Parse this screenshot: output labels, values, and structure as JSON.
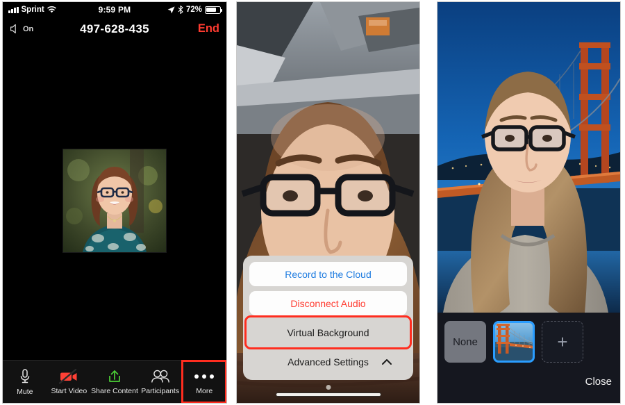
{
  "panel1": {
    "name": "zoom-meeting-in-call",
    "status_bar": {
      "signal_icon": "signal-bars-icon",
      "carrier": "Sprint",
      "wifi_icon": "wifi-icon",
      "time": "9:59 PM",
      "location_icon": "location-arrow-icon",
      "bluetooth_icon": "bluetooth-icon",
      "battery_percent": "72%",
      "battery_icon": "battery-icon"
    },
    "call_bar": {
      "speaker_icon": "speaker-icon",
      "speaker_state": "On",
      "meeting_id": "497-628-435",
      "end_label": "End"
    },
    "video_thumbnail": {
      "name": "participant-video-thumbnail",
      "alt": "participant headshot"
    },
    "toolbar": [
      {
        "icon": "microphone-icon",
        "label": "Mute",
        "highlighted": false
      },
      {
        "icon": "video-off-icon",
        "label": "Start Video",
        "highlighted": false
      },
      {
        "icon": "share-content-icon",
        "label": "Share Content",
        "highlighted": false
      },
      {
        "icon": "participants-icon",
        "label": "Participants",
        "highlighted": false
      },
      {
        "icon": "more-dots-icon",
        "label": "More",
        "highlighted": true
      }
    ]
  },
  "panel2": {
    "name": "more-action-sheet",
    "sheet_items": [
      {
        "label": "Record to the Cloud",
        "style": "blue",
        "highlighted": false
      },
      {
        "label": "Disconnect Audio",
        "style": "red",
        "highlighted": false
      },
      {
        "label": "Virtual Background",
        "style": "plain",
        "highlighted": true
      },
      {
        "label": "Advanced Settings",
        "style": "plain",
        "highlighted": false,
        "accessory_icon": "chevron-up-icon"
      }
    ],
    "home_indicator": "home-indicator"
  },
  "panel3": {
    "name": "virtual-background-picker",
    "backgrounds": [
      {
        "label": "None",
        "type": "none",
        "selected": false
      },
      {
        "label": "",
        "type": "image",
        "image_name": "golden-gate-bridge-background",
        "selected": true
      },
      {
        "label": "+",
        "type": "add",
        "selected": false
      }
    ],
    "close_label": "Close"
  },
  "colors": {
    "highlight_red": "#ff2d1f",
    "end_red": "#ff3b30",
    "accent_blue": "#1f7ce0",
    "selected_blue": "#2a9dff",
    "share_green": "#4cd137",
    "video_red": "#ff4136"
  }
}
